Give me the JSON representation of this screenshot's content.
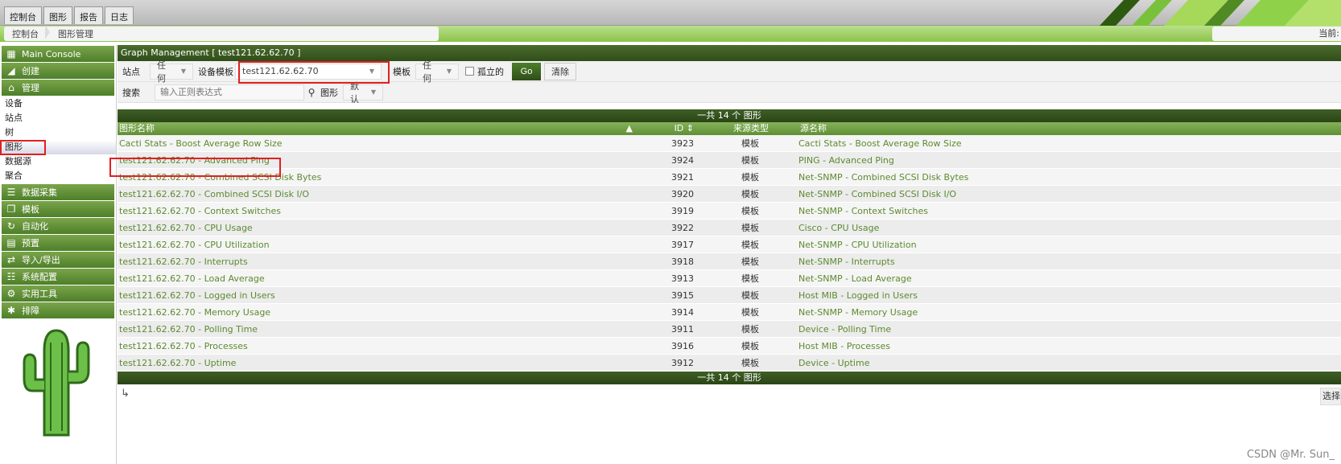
{
  "top_tabs": [
    "控制台",
    "图形",
    "报告",
    "日志"
  ],
  "breadcrumb": [
    "控制台",
    "图形管理"
  ],
  "breadcrumb_right": "当前:",
  "sidebar": {
    "main_console": "Main Console",
    "create": "创建",
    "manage": "管理",
    "manage_items": [
      "设备",
      "站点",
      "树",
      "图形",
      "数据源",
      "聚合"
    ],
    "sections": [
      "数据采集",
      "模板",
      "自动化",
      "预置",
      "导入/导出",
      "系统配置",
      "实用工具",
      "排障"
    ]
  },
  "panel": {
    "title": "Graph Management [ test121.62.62.70 ]",
    "filters": {
      "site_label": "站点",
      "site_value": "任何",
      "device_label": "设备模板",
      "device_value": "test121.62.62.70",
      "template_label": "模板",
      "template_value": "任何",
      "orphan_label": "孤立的",
      "go_label": "Go",
      "clear_label": "清除",
      "search_label": "搜索",
      "search_placeholder": "输入正则表达式",
      "graph_label": "图形",
      "graph_value": "默认"
    },
    "count_text": "一共 14 个 图形",
    "columns": [
      "图形名称",
      "ID",
      "来源类型",
      "源名称"
    ]
  },
  "rows": [
    {
      "name": "Cacti Stats - Boost Average Row Size",
      "id": "3923",
      "source": "模板",
      "ds": "Cacti Stats - Boost Average Row Size"
    },
    {
      "name": "test121.62.62.70 - Advanced Ping",
      "id": "3924",
      "source": "模板",
      "ds": "PING - Advanced Ping"
    },
    {
      "name": "test121.62.62.70 - Combined SCSI Disk Bytes",
      "id": "3921",
      "source": "模板",
      "ds": "Net-SNMP - Combined SCSI Disk Bytes"
    },
    {
      "name": "test121.62.62.70 - Combined SCSI Disk I/O",
      "id": "3920",
      "source": "模板",
      "ds": "Net-SNMP - Combined SCSI Disk I/O"
    },
    {
      "name": "test121.62.62.70 - Context Switches",
      "id": "3919",
      "source": "模板",
      "ds": "Net-SNMP - Context Switches"
    },
    {
      "name": "test121.62.62.70 - CPU Usage",
      "id": "3922",
      "source": "模板",
      "ds": "Cisco - CPU Usage"
    },
    {
      "name": "test121.62.62.70 - CPU Utilization",
      "id": "3917",
      "source": "模板",
      "ds": "Net-SNMP - CPU Utilization"
    },
    {
      "name": "test121.62.62.70 - Interrupts",
      "id": "3918",
      "source": "模板",
      "ds": "Net-SNMP - Interrupts"
    },
    {
      "name": "test121.62.62.70 - Load Average",
      "id": "3913",
      "source": "模板",
      "ds": "Net-SNMP - Load Average"
    },
    {
      "name": "test121.62.62.70 - Logged in Users",
      "id": "3915",
      "source": "模板",
      "ds": "Host MIB - Logged in Users"
    },
    {
      "name": "test121.62.62.70 - Memory Usage",
      "id": "3914",
      "source": "模板",
      "ds": "Net-SNMP - Memory Usage"
    },
    {
      "name": "test121.62.62.70 - Polling Time",
      "id": "3911",
      "source": "模板",
      "ds": "Device - Polling Time"
    },
    {
      "name": "test121.62.62.70 - Processes",
      "id": "3916",
      "source": "模板",
      "ds": "Host MIB - Processes"
    },
    {
      "name": "test121.62.62.70 - Uptime",
      "id": "3912",
      "source": "模板",
      "ds": "Device - Uptime"
    }
  ],
  "action_button": "选择",
  "watermark": "CSDN @Mr. Sun_",
  "colors": {
    "accent": "#4d7f2a",
    "link": "#5d8a2f",
    "highlight": "#e02020"
  }
}
